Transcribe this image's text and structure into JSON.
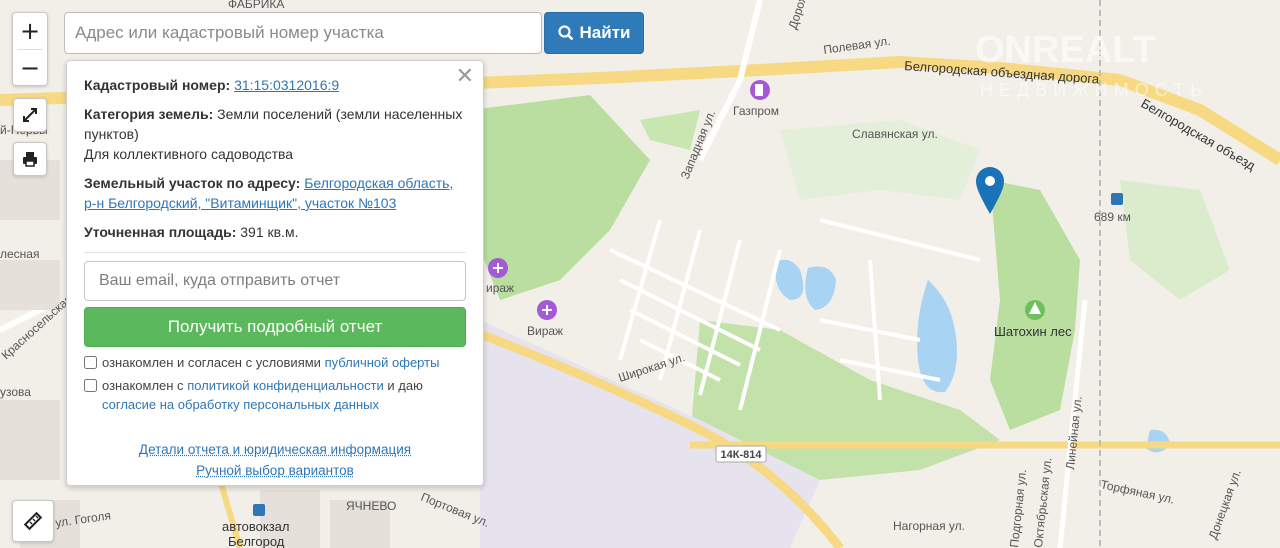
{
  "search": {
    "placeholder": "Адрес или кадастровый номер участка",
    "button_label": "Найти"
  },
  "zoom": {
    "in_label": "+",
    "out_label": "−"
  },
  "panel": {
    "cadastral_label": "Кадастровый номер:",
    "cadastral_value": "31:15:0312016:9",
    "category_label": "Категория земель:",
    "category_value": "Земли поселений (земли населенных пунктов)",
    "usage": "Для коллективного садоводства",
    "address_label": "Земельный участок по адресу:",
    "address_value": "Белгородская область, р-н Белгородский, \"Витаминщик\", участок №103",
    "area_label": "Уточненная площадь:",
    "area_value": "391 кв.м.",
    "email_placeholder": "Ваш email, куда отправить отчет",
    "report_button": "Получить подробный отчет",
    "agree1_text": "ознакомлен и согласен с условиями ",
    "agree1_link": "публичной оферты",
    "agree2_text": "ознакомлен с ",
    "agree2_link": "политикой конфиденциальности",
    "agree2_mid": " и даю",
    "agree2_link2": "согласие на обработку персональных данных",
    "details_link": "Детали отчета и юридическая информация",
    "manual_link": "Ручной выбор вариантов"
  },
  "map_labels": {
    "ring_road": "Белгородская объездная дорога",
    "ring_road2": "Белгородская объезд",
    "polevaya": "Полевая ул.",
    "gazprom": "Газпром",
    "slavyanskaya": "Славянская ул.",
    "zapadnaya": "Западная ул.",
    "km689": "689 км",
    "virazh1": "ираж",
    "virazh2": "Вираж",
    "shatokhin": "Шатохин лес",
    "shirokaya": "Широкая ул.",
    "road_code": "14К-814",
    "portovaya": "Портовая ул.",
    "yachnevo": "ЯЧНЕВО",
    "bus_station": "автовокзал",
    "belgorod": "Белгород",
    "gogolya": "ул. Гоголя",
    "nagornaya": "Нагорная ул.",
    "torfyanaya": "Торфяная ул.",
    "lineynaya": "Линейная ул.",
    "oktyabrskaya": "Октябрьская ул.",
    "podgornaya": "Подгорная ул.",
    "donetskaya": "Донецкая ул.",
    "fabrika": "ФАБРИКА",
    "doroga": "Дорож",
    "krasnoselskaya": "Красносельская ул.",
    "uzova": "узова",
    "pervy": "й-Первы",
    "leskaya": "лесная",
    "watermark": "ONREALT",
    "watermark_sub": "НЕДВИЖИМОСТЬ"
  },
  "colors": {
    "accent": "#2f7ab8",
    "success": "#5cb85c",
    "link": "#2f76b6",
    "forest": "#b9dea0",
    "water": "#a9d3f2",
    "road": "#f7d983",
    "marker": "#1a73b8"
  }
}
